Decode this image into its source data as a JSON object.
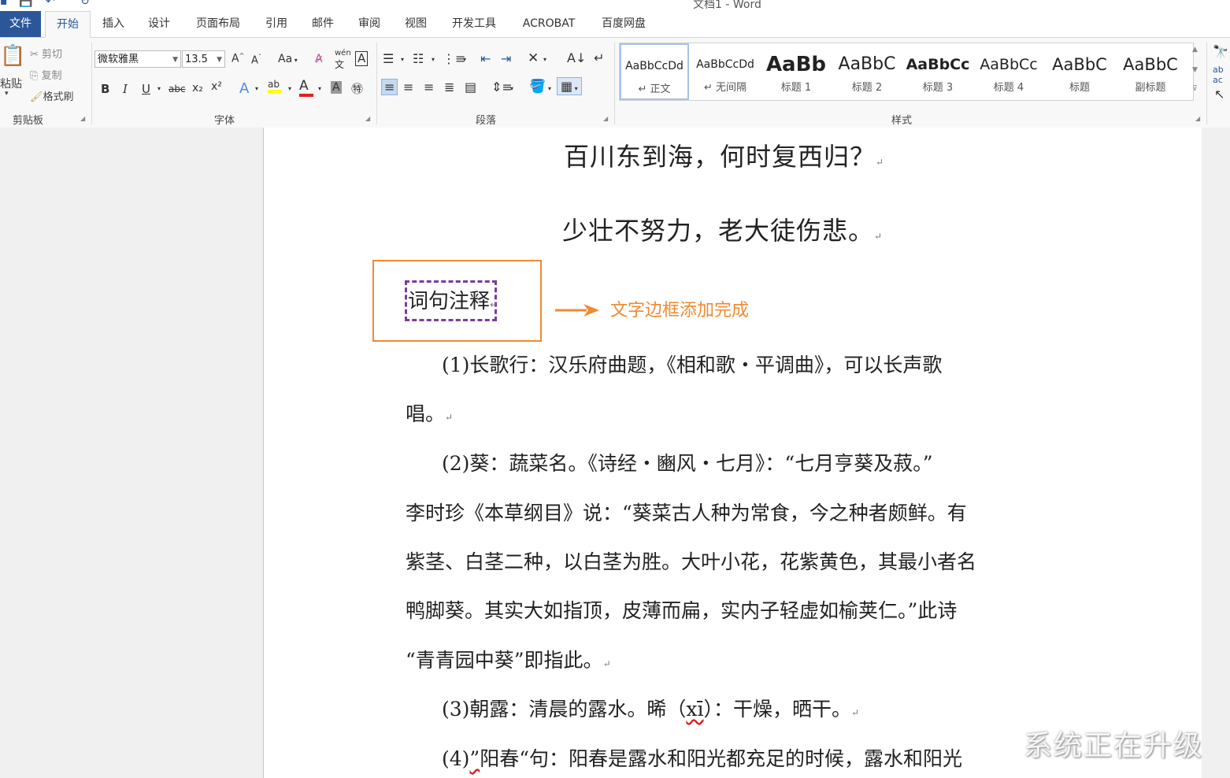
{
  "window": {
    "title": "文档1 - Word"
  },
  "tabs": [
    "文件",
    "开始",
    "插入",
    "设计",
    "页面布局",
    "引用",
    "邮件",
    "审阅",
    "视图",
    "开发工具",
    "ACROBAT",
    "百度网盘"
  ],
  "active_tab": "开始",
  "clipboard": {
    "paste": "粘贴",
    "cut": "剪切",
    "copy": "复制",
    "format_painter": "格式刷",
    "label": "剪贴板"
  },
  "font": {
    "name": "微软雅黑",
    "size": "13.5",
    "label": "字体",
    "bold": "B",
    "italic": "I",
    "underline": "U",
    "strike": "abc",
    "subscript": "x₂",
    "superscript": "x²",
    "grow": "A",
    "shrink": "A",
    "case": "Aa",
    "phonetic": "wén",
    "highlight_color": "#ffff00",
    "font_color": "#e02020"
  },
  "paragraph": {
    "label": "段落"
  },
  "styles": {
    "label": "样式",
    "items": [
      {
        "preview": "AaBbCcDd",
        "name": "↵ 正文"
      },
      {
        "preview": "AaBbCcDd",
        "name": "↵ 无间隔"
      },
      {
        "preview": "AaBb",
        "name": "标题 1"
      },
      {
        "preview": "AaBbC",
        "name": "标题 2"
      },
      {
        "preview": "AaBbCc",
        "name": "标题 3"
      },
      {
        "preview": "AaBbCc",
        "name": "标题 4"
      },
      {
        "preview": "AaBbC",
        "name": "标题"
      },
      {
        "preview": "AaBbC",
        "name": "副标题"
      }
    ]
  },
  "document": {
    "poem_line1": "百川东到海，何时复西归？",
    "poem_line2": "少壮不努力，老大徒伤悲。",
    "heading": "词句注释",
    "annotation": "文字边框添加完成",
    "pilcrow": "↵",
    "lines": [
      "(1)长歌行：汉乐府曲题，《相和歌・平调曲》，可以长声歌",
      "唱。",
      "(2)葵：蔬菜名。《诗经・豳风・七月》：“七月亨葵及菽。”",
      "李时珍《本草纲目》说：“葵菜古人种为常食，今之种者颇鲜。有",
      "紫茎、白茎二种，以白茎为胜。大叶小花，花紫黄色，其最小者名",
      "鸭脚葵。其实大如指顶，皮薄而扁，实内子轻虚如榆荚仁。”此诗",
      "“青青园中葵”即指此。",
      "(3)朝露：清晨的露水。晞（",
      "xī",
      "）：干燥，晒干。",
      "(4)",
      "”",
      "阳春“句：阳春是露水和阳光都充足的时候，露水和阳光"
    ]
  },
  "watermark": "系统正在升级",
  "colors": {
    "accent": "#2b579a",
    "annotation": "#ef8a33",
    "border_dashed": "#7b3aa0"
  }
}
